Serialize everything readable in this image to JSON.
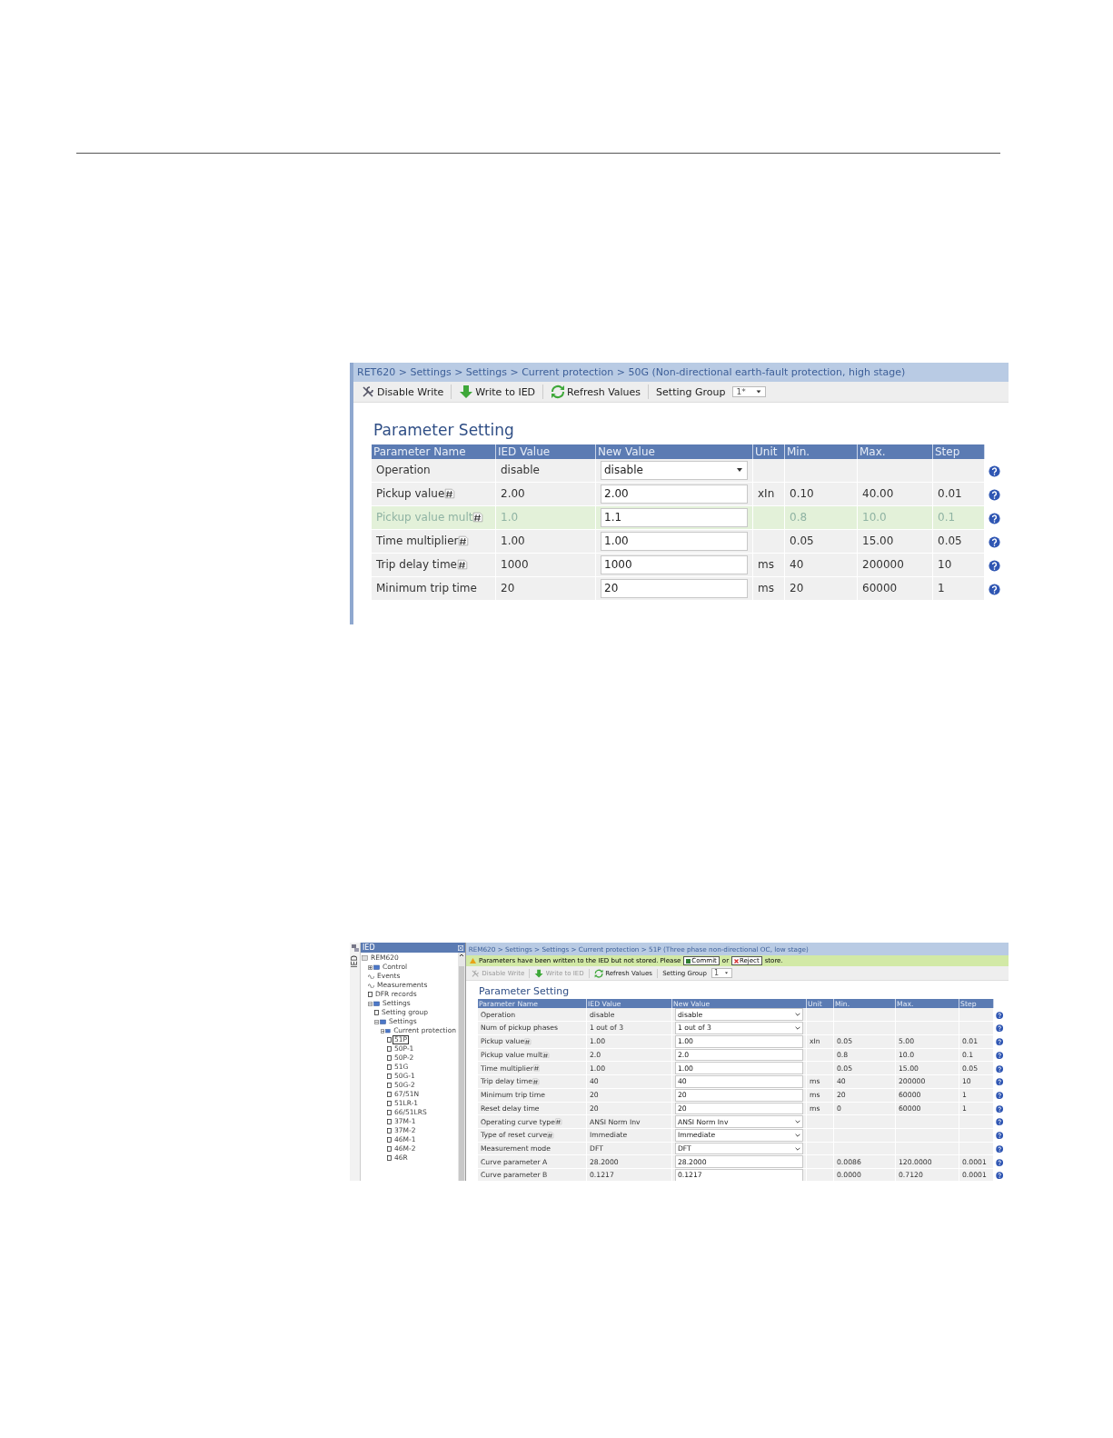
{
  "screens": [
    {
      "breadcrumb": "RET620 > Settings > Settings > Current protection > 50G (Non-directional earth-fault protection, high stage)",
      "toolbar": {
        "disable_write": "Disable Write",
        "write": "Write to IED",
        "refresh": "Refresh Values",
        "group_label": "Setting Group",
        "group_value": "1*",
        "disabled": false
      },
      "title": "Parameter Setting",
      "columns": [
        "Parameter Name",
        "IED Value",
        "New Value",
        "Unit",
        "Min.",
        "Max.",
        "Step"
      ],
      "rows": [
        {
          "name": "Operation",
          "note": false,
          "ied": "disable",
          "kind": "select",
          "value": "disable",
          "modified": false
        },
        {
          "name": "Pickup value",
          "note": true,
          "ied": "2.00",
          "kind": "input",
          "value": "2.00",
          "unit": "xIn",
          "min": "0.10",
          "max": "40.00",
          "step": "0.01",
          "modified": false
        },
        {
          "name": "Pickup value mult",
          "note": true,
          "ied": "1.0",
          "kind": "input",
          "value": "1.1",
          "min": "0.8",
          "max": "10.0",
          "step": "0.1",
          "modified": true
        },
        {
          "name": "Time multiplier",
          "note": true,
          "ied": "1.00",
          "kind": "input",
          "value": "1.00",
          "min": "0.05",
          "max": "15.00",
          "step": "0.05",
          "modified": false
        },
        {
          "name": "Trip delay time",
          "note": true,
          "ied": "1000",
          "kind": "input",
          "value": "1000",
          "unit": "ms",
          "min": "40",
          "max": "200000",
          "step": "10",
          "modified": false
        },
        {
          "name": "Minimum trip time",
          "note": false,
          "ied": "20",
          "kind": "input",
          "value": "20",
          "unit": "ms",
          "min": "20",
          "max": "60000",
          "step": "1",
          "modified": false
        }
      ]
    },
    {
      "tree": {
        "title": "IED",
        "tab": "IED",
        "items": [
          {
            "label": "REM620",
            "kind": "device",
            "selected": false,
            "children": [
              {
                "label": "Control",
                "kind": "folder",
                "expanded": false,
                "selected": false
              },
              {
                "label": "Events",
                "kind": "wave",
                "selected": false
              },
              {
                "label": "Measurements",
                "kind": "wave",
                "selected": false
              },
              {
                "label": "DFR records",
                "kind": "leaf",
                "selected": false
              },
              {
                "label": "Settings",
                "kind": "folder",
                "expanded": true,
                "selected": false,
                "children": [
                  {
                    "label": "Setting group",
                    "kind": "leaf",
                    "selected": false
                  },
                  {
                    "label": "Settings",
                    "kind": "folder",
                    "expanded": true,
                    "selected": false,
                    "children": [
                      {
                        "label": "Current protection",
                        "kind": "folder",
                        "expanded": true,
                        "selected": false,
                        "children": [
                          {
                            "label": "51P",
                            "kind": "leaf",
                            "selected": true
                          },
                          {
                            "label": "50P-1",
                            "kind": "leaf",
                            "selected": false
                          },
                          {
                            "label": "50P-2",
                            "kind": "leaf",
                            "selected": false
                          },
                          {
                            "label": "51G",
                            "kind": "leaf",
                            "selected": false
                          },
                          {
                            "label": "50G-1",
                            "kind": "leaf",
                            "selected": false
                          },
                          {
                            "label": "50G-2",
                            "kind": "leaf",
                            "selected": false
                          },
                          {
                            "label": "67/51N",
                            "kind": "leaf",
                            "selected": false
                          },
                          {
                            "label": "51LR-1",
                            "kind": "leaf",
                            "selected": false
                          },
                          {
                            "label": "66/51LRS",
                            "kind": "leaf",
                            "selected": false
                          },
                          {
                            "label": "37M-1",
                            "kind": "leaf",
                            "selected": false
                          },
                          {
                            "label": "37M-2",
                            "kind": "leaf",
                            "selected": false
                          },
                          {
                            "label": "46M-1",
                            "kind": "leaf",
                            "selected": false
                          },
                          {
                            "label": "46M-2",
                            "kind": "leaf",
                            "selected": false
                          },
                          {
                            "label": "46R",
                            "kind": "leaf",
                            "selected": false
                          }
                        ]
                      }
                    ]
                  }
                ]
              }
            ]
          }
        ]
      },
      "breadcrumb": "REM620 > Settings > Settings > Current protection > 51P (Three phase non-directional OC, low stage)",
      "notice": {
        "before": "Parameters have been written to the IED but not stored. Please",
        "commit": "Commit",
        "or": "or",
        "reject": "Reject",
        "after": "store."
      },
      "toolbar": {
        "disable_write": "Disable Write",
        "write": "Write to IED",
        "refresh": "Refresh Values",
        "group_label": "Setting Group",
        "group_value": "1",
        "disabled": true
      },
      "title": "Parameter Setting",
      "columns": [
        "Parameter Name",
        "IED Value",
        "New Value",
        "Unit",
        "Min.",
        "Max.",
        "Step"
      ],
      "rows": [
        {
          "name": "Operation",
          "note": false,
          "ied": "disable",
          "kind": "select",
          "value": "disable",
          "modified": false
        },
        {
          "name": "Num of pickup phases",
          "note": false,
          "ied": "1 out of 3",
          "kind": "select",
          "value": "1 out of 3",
          "modified": false
        },
        {
          "name": "Pickup value",
          "note": true,
          "ied": "1.00",
          "kind": "input",
          "value": "1.00",
          "unit": "xIn",
          "min": "0.05",
          "max": "5.00",
          "step": "0.01",
          "modified": false
        },
        {
          "name": "Pickup value mult",
          "note": true,
          "ied": "2.0",
          "kind": "input",
          "value": "2.0",
          "min": "0.8",
          "max": "10.0",
          "step": "0.1",
          "modified": false
        },
        {
          "name": "Time multiplier",
          "note": true,
          "ied": "1.00",
          "kind": "input",
          "value": "1.00",
          "min": "0.05",
          "max": "15.00",
          "step": "0.05",
          "modified": false
        },
        {
          "name": "Trip delay time",
          "note": true,
          "ied": "40",
          "kind": "input",
          "value": "40",
          "unit": "ms",
          "min": "40",
          "max": "200000",
          "step": "10",
          "modified": false
        },
        {
          "name": "Minimum trip time",
          "note": false,
          "ied": "20",
          "kind": "input",
          "value": "20",
          "unit": "ms",
          "min": "20",
          "max": "60000",
          "step": "1",
          "modified": false
        },
        {
          "name": "Reset delay time",
          "note": false,
          "ied": "20",
          "kind": "input",
          "value": "20",
          "unit": "ms",
          "min": "0",
          "max": "60000",
          "step": "1",
          "modified": false
        },
        {
          "name": "Operating curve type",
          "note": true,
          "ied": "ANSI Norm Inv",
          "kind": "select",
          "value": "ANSI Norm Inv",
          "modified": false
        },
        {
          "name": "Type of reset curve",
          "note": true,
          "ied": "Immediate",
          "kind": "select",
          "value": "Immediate",
          "modified": false
        },
        {
          "name": "Measurement mode",
          "note": false,
          "ied": "DFT",
          "kind": "select",
          "value": "DFT",
          "modified": false
        },
        {
          "name": "Curve parameter A",
          "note": false,
          "ied": "28.2000",
          "kind": "input",
          "value": "28.2000",
          "min": "0.0086",
          "max": "120.0000",
          "step": "0.0001",
          "modified": false
        },
        {
          "name": "Curve parameter B",
          "note": false,
          "ied": "0.1217",
          "kind": "input",
          "value": "0.1217",
          "min": "0.0000",
          "max": "0.7120",
          "step": "0.0001",
          "modified": false
        }
      ]
    }
  ]
}
